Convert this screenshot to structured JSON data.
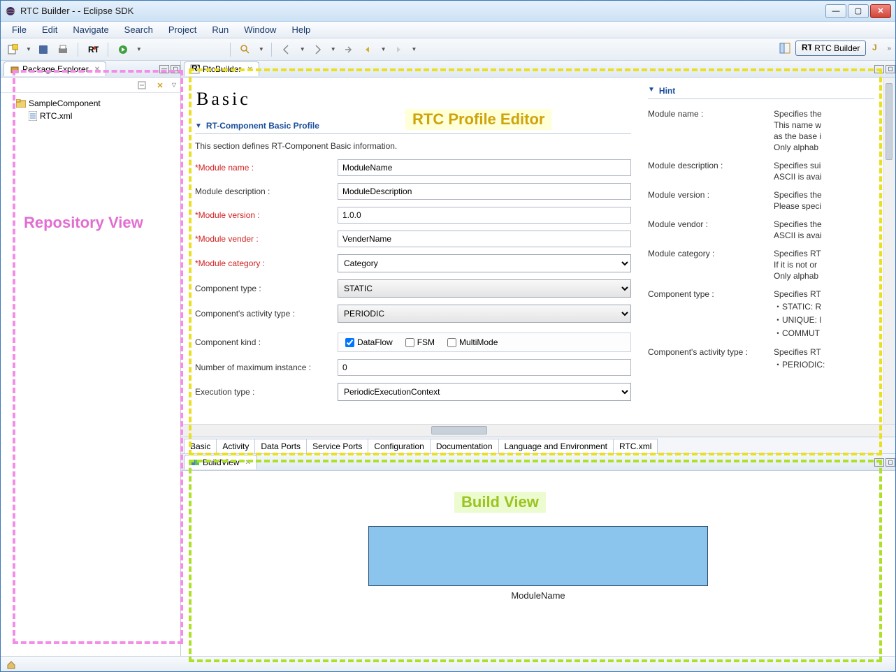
{
  "window": {
    "title": "RTC Builder -  - Eclipse SDK"
  },
  "menubar": [
    "File",
    "Edit",
    "Navigate",
    "Search",
    "Project",
    "Run",
    "Window",
    "Help"
  ],
  "perspective": {
    "open_icon": "open-perspective",
    "active_label": "RTC Builder"
  },
  "package_explorer": {
    "tab_label": "Package Explorer",
    "items": [
      {
        "label": "SampleComponent",
        "type": "folder"
      },
      {
        "label": "RTC.xml",
        "type": "file"
      }
    ]
  },
  "annotations": {
    "repository": "Repository View",
    "profile": "RTC Profile Editor",
    "build": "Build View"
  },
  "editor": {
    "tab_label": "RtcBuilder",
    "header": "Basic",
    "section_title": "RT-Component Basic Profile",
    "section_desc": "This section defines RT-Component Basic information.",
    "fields": {
      "module_name": {
        "label": "*Module name :",
        "value": "ModuleName",
        "required": true
      },
      "module_desc": {
        "label": "Module description :",
        "value": "ModuleDescription",
        "required": false
      },
      "module_version": {
        "label": "*Module version :",
        "value": "1.0.0",
        "required": true
      },
      "module_vender": {
        "label": "*Module vender :",
        "value": "VenderName",
        "required": true
      },
      "module_category": {
        "label": "*Module category :",
        "value": "Category",
        "required": true
      },
      "component_type": {
        "label": "Component type :",
        "value": "STATIC"
      },
      "activity_type": {
        "label": "Component's activity type :",
        "value": "PERIODIC"
      },
      "component_kind": {
        "label": "Component kind :",
        "checks": [
          {
            "label": "DataFlow",
            "checked": true
          },
          {
            "label": "FSM",
            "checked": false
          },
          {
            "label": "MultiMode",
            "checked": false
          }
        ]
      },
      "max_instance": {
        "label": "Number of maximum instance :",
        "value": "0"
      },
      "execution_type": {
        "label": "Execution type :",
        "value": "PeriodicExecutionContext"
      }
    },
    "hint": {
      "title": "Hint",
      "rows": [
        {
          "key": "Module name :",
          "val": "Specifies the"
        },
        {
          "key": "",
          "val": "This name w"
        },
        {
          "key": "",
          "val": "as the base i"
        },
        {
          "key": "",
          "val": "Only alphab"
        },
        {
          "key": "Module description :",
          "val": "Specifies sui"
        },
        {
          "key": "",
          "val": "ASCII is avai"
        },
        {
          "key": "Module version :",
          "val": "Specifies the"
        },
        {
          "key": "",
          "val": "Please speci"
        },
        {
          "key": "Module vendor :",
          "val": "Specifies the"
        },
        {
          "key": "",
          "val": "ASCII is avai"
        },
        {
          "key": "Module category :",
          "val": "Specifies RT"
        },
        {
          "key": "",
          "val": "If it is not or"
        },
        {
          "key": "",
          "val": "Only alphab"
        },
        {
          "key": "Component type :",
          "val": "Specifies RT"
        },
        {
          "key": "",
          "val": "・STATIC: R"
        },
        {
          "key": "",
          "val": "・UNIQUE: l"
        },
        {
          "key": "",
          "val": "・COMMUT"
        },
        {
          "key": "Component's activity type :",
          "val": "Specifies RT"
        },
        {
          "key": "",
          "val": "・PERIODIC:"
        }
      ]
    },
    "bottom_tabs": [
      "Basic",
      "Activity",
      "Data Ports",
      "Service Ports",
      "Configuration",
      "Documentation",
      "Language and Environment",
      "RTC.xml"
    ]
  },
  "build_view": {
    "tab_label": "BuildView",
    "module_label": "ModuleName"
  }
}
